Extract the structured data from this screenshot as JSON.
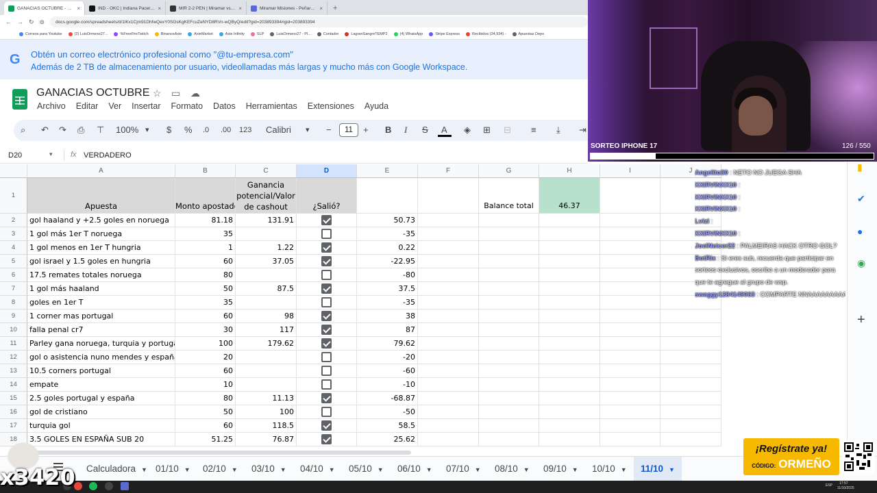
{
  "browser": {
    "tabs": [
      {
        "title": "GANACIAS OCTUBRE - Hojas de cálculo",
        "color": "#0f9d58"
      },
      {
        "title": "IND - OKC | Indiana Pacers vs O",
        "color": "#111111"
      },
      {
        "title": "MIR 2-2 PEN | Miramar vs Peñarol",
        "color": "#333333"
      },
      {
        "title": "Miramar Misiones - Peñarol en",
        "color": "#5b6ad0"
      }
    ],
    "new_tab": "+",
    "url": "docs.google.com/spreadsheets/d/1lKx1Cjm91DhfwQexY0SGsKgKEFcuZeNYD8RVn-wQByQ/edit?gid=203893394#gid=203893394",
    "bookmarks": [
      {
        "label": "Correos para Youtube",
        "color": "#4285f4"
      },
      {
        "label": "(2) LuisOrmeno27...",
        "color": "#e94b3c"
      },
      {
        "label": "%FreeFireTwitch",
        "color": "#9146ff"
      },
      {
        "label": "BinanceAxie",
        "color": "#f0b90b"
      },
      {
        "label": "AxieMarket",
        "color": "#35a8e0"
      },
      {
        "label": "Axie Infinity",
        "color": "#35a8e0"
      },
      {
        "label": "SLP",
        "color": "#e8739b"
      },
      {
        "label": "LuisOrmeno27 - Pl...",
        "color": "#5f6368"
      },
      {
        "label": "Contador",
        "color": "#5f6368"
      },
      {
        "label": "LagranSangreTEMP2",
        "color": "#d93025"
      },
      {
        "label": "(4) WhatsApp",
        "color": "#25d366"
      },
      {
        "label": "Stripe Express",
        "color": "#635bff"
      },
      {
        "label": "Recibidos (34,934) -",
        "color": "#ea4335"
      },
      {
        "label": "Apuestas Depo",
        "color": "#5f6368"
      }
    ]
  },
  "banner": {
    "logo": "G",
    "line1": "Obtén un correo electrónico profesional como \"@tu-empresa.com\"",
    "line2": "Además de 2 TB de almacenamiento por usuario, videollamadas más largas y mucho más con Google Workspace."
  },
  "doc": {
    "title": "GANACIAS OCTUBRE",
    "menu": [
      "Archivo",
      "Editar",
      "Ver",
      "Insertar",
      "Formato",
      "Datos",
      "Herramientas",
      "Extensiones",
      "Ayuda"
    ]
  },
  "toolbar": {
    "zoom": "100%",
    "currency": "$",
    "percent": "%",
    "dec_less": ".0",
    "dec_more": ".00",
    "number_format": "123",
    "font": "Calibri",
    "font_size": "11",
    "minus": "−",
    "plus": "+",
    "bold": "B",
    "italic": "I",
    "strike": "S",
    "text_color": "A"
  },
  "formula_bar": {
    "cell_ref": "D20",
    "fx": "fx",
    "value": "VERDADERO"
  },
  "columns": [
    "A",
    "B",
    "C",
    "D",
    "E",
    "F",
    "G",
    "H",
    "I",
    "J"
  ],
  "header_row": {
    "a": "Apuesta",
    "b": "Monto apostado",
    "c": "Ganancia potencial/Valor de cashout",
    "d": "¿Salió?",
    "g": "Balance total",
    "h": "46.37"
  },
  "rows": [
    {
      "n": "2",
      "a": "gol haaland y +2.5 goles en noruega",
      "b": "81.18",
      "c": "131.91",
      "d": true,
      "e": "50.73"
    },
    {
      "n": "3",
      "a": "1 gol más 1er T noruega",
      "b": "35",
      "c": "",
      "d": false,
      "e": "-35"
    },
    {
      "n": "4",
      "a": "1 gol menos en 1er T hungria",
      "b": "1",
      "c": "1.22",
      "d": true,
      "e": "0.22"
    },
    {
      "n": "5",
      "a": "gol israel y 1.5 goles en hungria",
      "b": "60",
      "c": "37.05",
      "d": true,
      "e": "-22.95"
    },
    {
      "n": "6",
      "a": "17.5 remates totales noruega",
      "b": "80",
      "c": "",
      "d": false,
      "e": "-80"
    },
    {
      "n": "7",
      "a": "1 gol más haaland",
      "b": "50",
      "c": "87.5",
      "d": true,
      "e": "37.5"
    },
    {
      "n": "8",
      "a": "goles en 1er T",
      "b": "35",
      "c": "",
      "d": false,
      "e": "-35"
    },
    {
      "n": "9",
      "a": "1 corner mas portugal",
      "b": "60",
      "c": "98",
      "d": true,
      "e": "38"
    },
    {
      "n": "10",
      "a": "falla penal cr7",
      "b": "30",
      "c": "117",
      "d": true,
      "e": "87"
    },
    {
      "n": "11",
      "a": "Parley gana noruega, turquia y portugal",
      "b": "100",
      "c": "179.62",
      "d": true,
      "e": "79.62"
    },
    {
      "n": "12",
      "a": "gol o asistencia nuno mendes y españa",
      "b": "20",
      "c": "",
      "d": false,
      "e": "-20"
    },
    {
      "n": "13",
      "a": "10.5 corners portugal",
      "b": "60",
      "c": "",
      "d": false,
      "e": "-60"
    },
    {
      "n": "14",
      "a": "empate",
      "b": "10",
      "c": "",
      "d": false,
      "e": "-10"
    },
    {
      "n": "15",
      "a": "2.5 goles portugal y españa",
      "b": "80",
      "c": "11.13",
      "d": true,
      "e": "-68.87"
    },
    {
      "n": "16",
      "a": "gol de cristiano",
      "b": "50",
      "c": "100",
      "d": false,
      "e": "-50"
    },
    {
      "n": "17",
      "a": "turquia gol",
      "b": "60",
      "c": "118.5",
      "d": true,
      "e": "58.5"
    },
    {
      "n": "18",
      "a": "3.5 GOLES EN ESPAÑA SUB 20",
      "b": "51.25",
      "c": "76.87",
      "d": true,
      "e": "25.62"
    }
  ],
  "sheets": [
    {
      "label": "Calculadora",
      "active": false
    },
    {
      "label": "01/10",
      "active": false
    },
    {
      "label": "02/10",
      "active": false
    },
    {
      "label": "03/10",
      "active": false
    },
    {
      "label": "04/10",
      "active": false
    },
    {
      "label": "05/10",
      "active": false
    },
    {
      "label": "06/10",
      "active": false
    },
    {
      "label": "07/10",
      "active": false
    },
    {
      "label": "08/10",
      "active": false
    },
    {
      "label": "09/10",
      "active": false
    },
    {
      "label": "10/10",
      "active": false
    },
    {
      "label": "11/10",
      "active": true
    }
  ],
  "side_panel": {
    "plus": "+"
  },
  "stream": {
    "title": "SORTEO IPHONE 17",
    "count": "126 / 550",
    "progress": 0.229,
    "chat": [
      {
        "user": "Angelito30",
        "text": "NETO NO JUEGA SHA"
      },
      {
        "user": "XXIRVINXX10",
        "text": ""
      },
      {
        "user": "XXIRVINXX10",
        "text": ""
      },
      {
        "user": "XXIRVINXX10",
        "text": ""
      },
      {
        "user": "Lvizi",
        "text": ""
      },
      {
        "user": "XXIRVINXX10",
        "text": ""
      },
      {
        "user": "JoelNeicer22",
        "text": "PALMEIRAS HACK OTRO GOL?"
      },
      {
        "user": "BotRix",
        "text": "Si eres sub, recuerda que participar en sorteos exclusivos, escribe a un moderador para que te agregue al grupo de wsp."
      },
      {
        "user": "swaggy1284149063",
        "text": "COMPARTE NNAAAAAAAAAAA"
      }
    ],
    "promo_title": "¡Regístrate ya!",
    "promo_code_label": "CÓDIGO:",
    "promo_code": "ORMEÑO",
    "overlay_number": "x3420"
  },
  "taskbar": {
    "lang": "ESP",
    "time": "17:57",
    "date": "11/10/2025"
  }
}
